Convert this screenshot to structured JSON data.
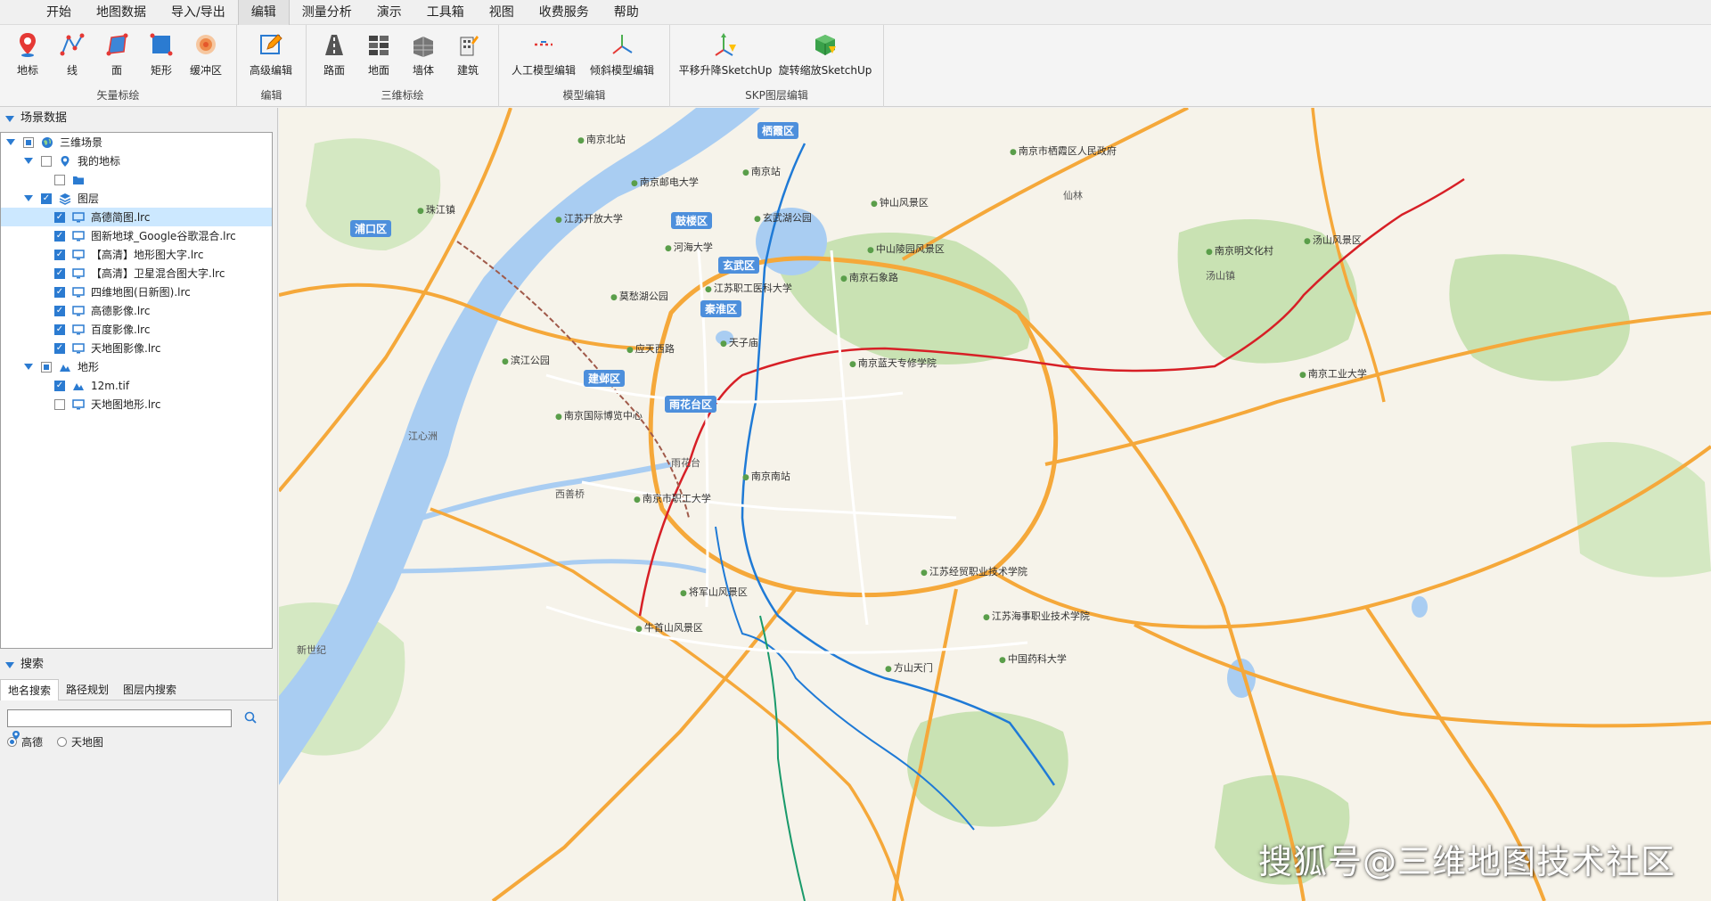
{
  "menu": [
    "开始",
    "地图数据",
    "导入/导出",
    "编辑",
    "测量分析",
    "演示",
    "工具箱",
    "视图",
    "收费服务",
    "帮助"
  ],
  "active_menu_index": 3,
  "ribbon": {
    "groups": [
      {
        "title": "矢量标绘",
        "buttons": [
          "地标",
          "线",
          "面",
          "矩形",
          "缓冲区"
        ]
      },
      {
        "title": "编辑",
        "buttons": [
          "高级编辑"
        ]
      },
      {
        "title": "三维标绘",
        "buttons": [
          "路面",
          "地面",
          "墙体",
          "建筑"
        ]
      },
      {
        "title": "模型编辑",
        "buttons": [
          "人工模型编辑",
          "倾斜模型编辑"
        ]
      },
      {
        "title": "SKP图层编辑",
        "buttons": [
          "平移升降SketchUp",
          "旋转缩放SketchUp"
        ]
      }
    ]
  },
  "scene_panel": {
    "title": "场景数据",
    "root": "三维场景",
    "my_marks": "我的地标",
    "layers_label": "图层",
    "layers": [
      {
        "name": "高德简图.lrc",
        "checked": true
      },
      {
        "name": "图新地球_Google谷歌混合.lrc",
        "checked": true
      },
      {
        "name": "【高清】地形图大字.lrc",
        "checked": true
      },
      {
        "name": "【高清】卫星混合图大字.lrc",
        "checked": true
      },
      {
        "name": "四维地图(日新图).lrc",
        "checked": true
      },
      {
        "name": "高德影像.lrc",
        "checked": true
      },
      {
        "name": "百度影像.lrc",
        "checked": true
      },
      {
        "name": "天地图影像.lrc",
        "checked": true
      }
    ],
    "terrain_label": "地形",
    "terrain": [
      {
        "name": "12m.tif",
        "checked": true
      },
      {
        "name": "天地图地形.lrc",
        "checked": false
      }
    ]
  },
  "search_panel": {
    "title": "搜索",
    "tabs": [
      "地名搜索",
      "路径规划",
      "图层内搜索"
    ],
    "input_value": "",
    "options": [
      "高德",
      "天地图"
    ],
    "selected_option": "高德"
  },
  "map": {
    "districts": [
      "栖霞区",
      "鼓楼区",
      "玄武区",
      "秦淮区",
      "建邺区",
      "雨花台区",
      "浦口区"
    ],
    "places": [
      "南京市栖霞区人民政府",
      "南京北站",
      "南京站",
      "玄武湖公园",
      "钟山风景区",
      "中山陵园风景区",
      "南京石象路",
      "南京邮电大学",
      "江苏开放大学",
      "河海大学",
      "莫愁湖公园",
      "江苏职工医科大学",
      "南京国际博览中心",
      "应天西路",
      "天子庙",
      "南京蓝天专修学院",
      "南京南站",
      "南京市职工大学",
      "江苏经贸职业技术学院",
      "江苏海事职业技术学院",
      "中国药科大学",
      "南京工业大学",
      "南京明文化村",
      "汤山风景区",
      "珠江镇",
      "将军山风景区",
      "牛首山风景区",
      "方山天门",
      "汤山镇",
      "雨花台",
      "仙林",
      "江心洲",
      "滨江公园",
      "西善桥",
      "新世纪"
    ],
    "watermark": "搜狐号@三维地图技术社区"
  }
}
